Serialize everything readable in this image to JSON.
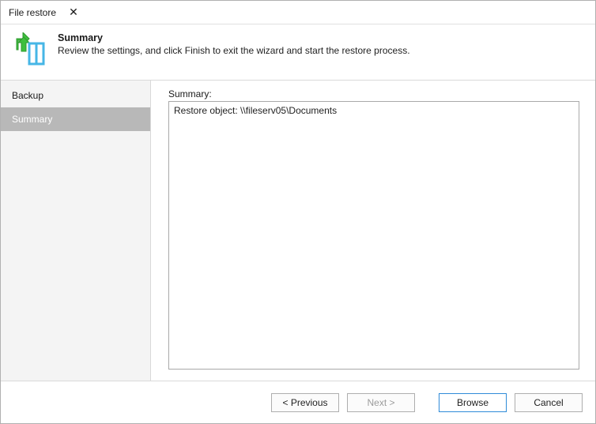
{
  "titlebar": {
    "title": "File restore"
  },
  "header": {
    "title": "Summary",
    "subtitle": "Review the settings, and click Finish to exit the wizard and start the restore process."
  },
  "sidebar": {
    "items": [
      {
        "label": "Backup",
        "active": false
      },
      {
        "label": "Summary",
        "active": true
      }
    ]
  },
  "content": {
    "summary_label": "Summary:",
    "summary_lines": [
      "Restore object: \\\\fileserv05\\Documents"
    ]
  },
  "footer": {
    "previous_label": "< Previous",
    "next_label": "Next >",
    "browse_label": "Browse",
    "cancel_label": "Cancel",
    "next_enabled": false
  },
  "icons": {
    "restore_icon": "restore-arrow-box"
  }
}
